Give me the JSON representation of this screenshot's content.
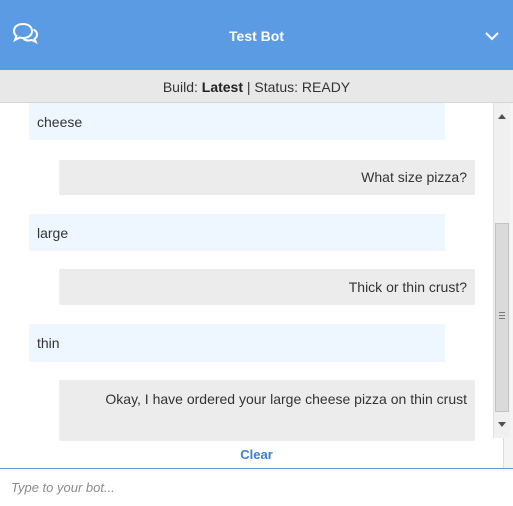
{
  "header": {
    "title": "Test Bot",
    "accent_color": "#5a9be4",
    "chat_icon": "chat-bubbles-icon",
    "collapse_icon": "chevron-down-icon"
  },
  "status_bar": {
    "build_label": "Build:",
    "build_value": "Latest",
    "separator": "|",
    "status_label": "Status:",
    "status_value": "READY"
  },
  "conversation": {
    "messages": [
      {
        "sender": "user",
        "text": "cheese"
      },
      {
        "sender": "bot",
        "text": "What size pizza?"
      },
      {
        "sender": "user",
        "text": "large"
      },
      {
        "sender": "bot",
        "text": "Thick or thin crust?"
      },
      {
        "sender": "user",
        "text": "thin"
      },
      {
        "sender": "bot",
        "text": "Okay, I have ordered your large cheese pizza on thin crust"
      }
    ]
  },
  "clear_label": "Clear",
  "input": {
    "placeholder": "Type to your bot...",
    "value": ""
  }
}
